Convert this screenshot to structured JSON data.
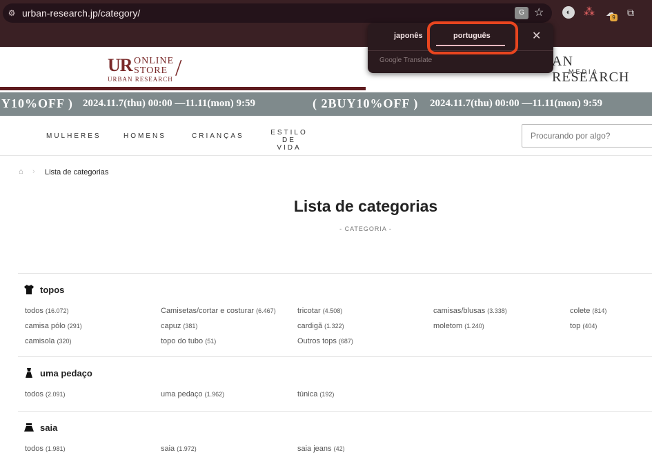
{
  "browser": {
    "url_host": "urban-research.jp",
    "url_path": "/category/",
    "ext_badge": "9"
  },
  "translate_popup": {
    "tab_japanese": "japonês",
    "tab_portuguese": "português",
    "footer": "Google Translate",
    "close_glyph": "✕"
  },
  "header": {
    "logo_ur": "UR",
    "logo_online": "ONLINE",
    "logo_store": "STORE",
    "logo_sub": "URBAN RESEARCH",
    "media_logo": "AN RESEARCH",
    "media_sub": "MEDIA"
  },
  "banner": {
    "left_promo": "Y10%OFF )",
    "left_date": "2024.11.7(thu) 00:00 —11.11(mon) 9:59",
    "right_promo": "( 2BUY10%OFF )",
    "right_date": "2024.11.7(thu) 00:00 —11.11(mon) 9:59"
  },
  "nav": {
    "items": [
      "MULHERES",
      "HOMENS",
      "CRIANÇAS"
    ],
    "item4_line1": "ESTILO DE",
    "item4_line2": "VIDA",
    "search_placeholder": "Procurando por algo?"
  },
  "breadcrumb": {
    "current": "Lista de categorias"
  },
  "page": {
    "title": "Lista de categorias",
    "subtitle": "- CATEGORIA -"
  },
  "categories": [
    {
      "name": "topos",
      "icon": "tshirt-icon",
      "links": [
        {
          "label": "todos",
          "count": "(16.072)"
        },
        {
          "label": "Camisetas/cortar e costurar",
          "count": "(6.467)"
        },
        {
          "label": "tricotar",
          "count": "(4.508)"
        },
        {
          "label": "camisas/blusas",
          "count": "(3.338)"
        },
        {
          "label": "colete",
          "count": "(814)"
        },
        {
          "label": "camisa pólo",
          "count": "(291)"
        },
        {
          "label": "capuz",
          "count": "(381)"
        },
        {
          "label": "cardigã",
          "count": "(1.322)"
        },
        {
          "label": "moletom",
          "count": "(1.240)"
        },
        {
          "label": "top",
          "count": "(404)"
        },
        {
          "label": "camisola",
          "count": "(320)"
        },
        {
          "label": "topo do tubo",
          "count": "(51)"
        },
        {
          "label": "Outros tops",
          "count": "(687)"
        }
      ]
    },
    {
      "name": "uma pedaço",
      "icon": "dress-icon",
      "links": [
        {
          "label": "todos",
          "count": "(2.091)"
        },
        {
          "label": "uma pedaço",
          "count": "(1.962)"
        },
        {
          "label": "túnica",
          "count": "(192)"
        }
      ]
    },
    {
      "name": "saia",
      "icon": "skirt-icon",
      "links": [
        {
          "label": "todos",
          "count": "(1.981)"
        },
        {
          "label": "saia",
          "count": "(1.972)"
        },
        {
          "label": "saia jeans",
          "count": "(42)"
        }
      ]
    }
  ]
}
